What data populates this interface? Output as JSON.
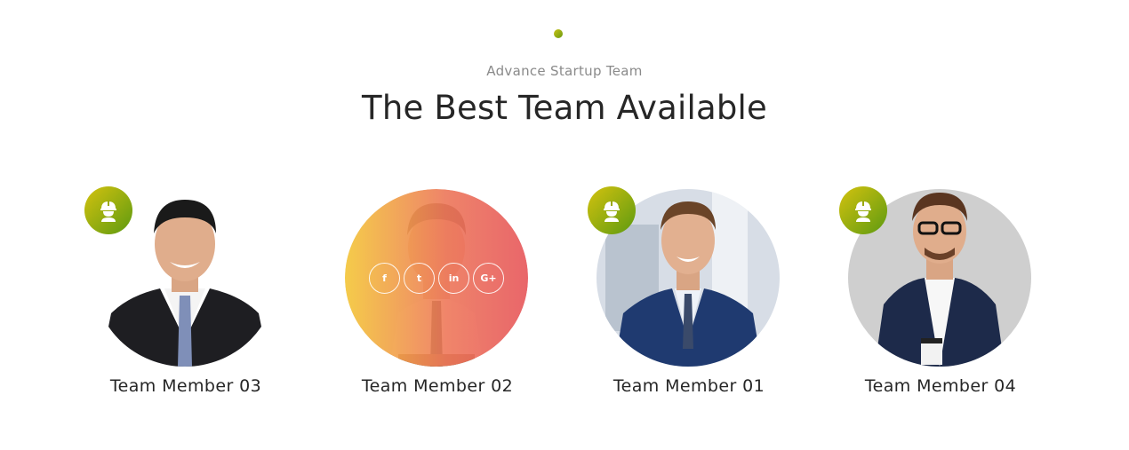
{
  "header": {
    "subtitle": "Advance Startup Team",
    "title": "The Best Team Available"
  },
  "members": [
    {
      "name": "Team Member 03",
      "badge_icon": "worker-helmet-icon",
      "show_badge": true,
      "show_overlay": false
    },
    {
      "name": "Team Member 02",
      "badge_icon": "",
      "show_badge": false,
      "show_overlay": true
    },
    {
      "name": "Team Member 01",
      "badge_icon": "worker-helmet-icon",
      "show_badge": true,
      "show_overlay": false
    },
    {
      "name": "Team Member 04",
      "badge_icon": "worker-helmet-icon",
      "show_badge": true,
      "show_overlay": false
    }
  ],
  "social_links": [
    {
      "icon": "facebook-icon",
      "glyph": "f"
    },
    {
      "icon": "twitter-icon",
      "glyph": "t"
    },
    {
      "icon": "linkedin-icon",
      "glyph": "in"
    },
    {
      "icon": "google-plus-icon",
      "glyph": "G+"
    }
  ],
  "colors": {
    "accent_from": "#d4c20f",
    "accent_to": "#5d9a10",
    "overlay_from": "#f5c83c",
    "overlay_to": "#e85a5f"
  }
}
